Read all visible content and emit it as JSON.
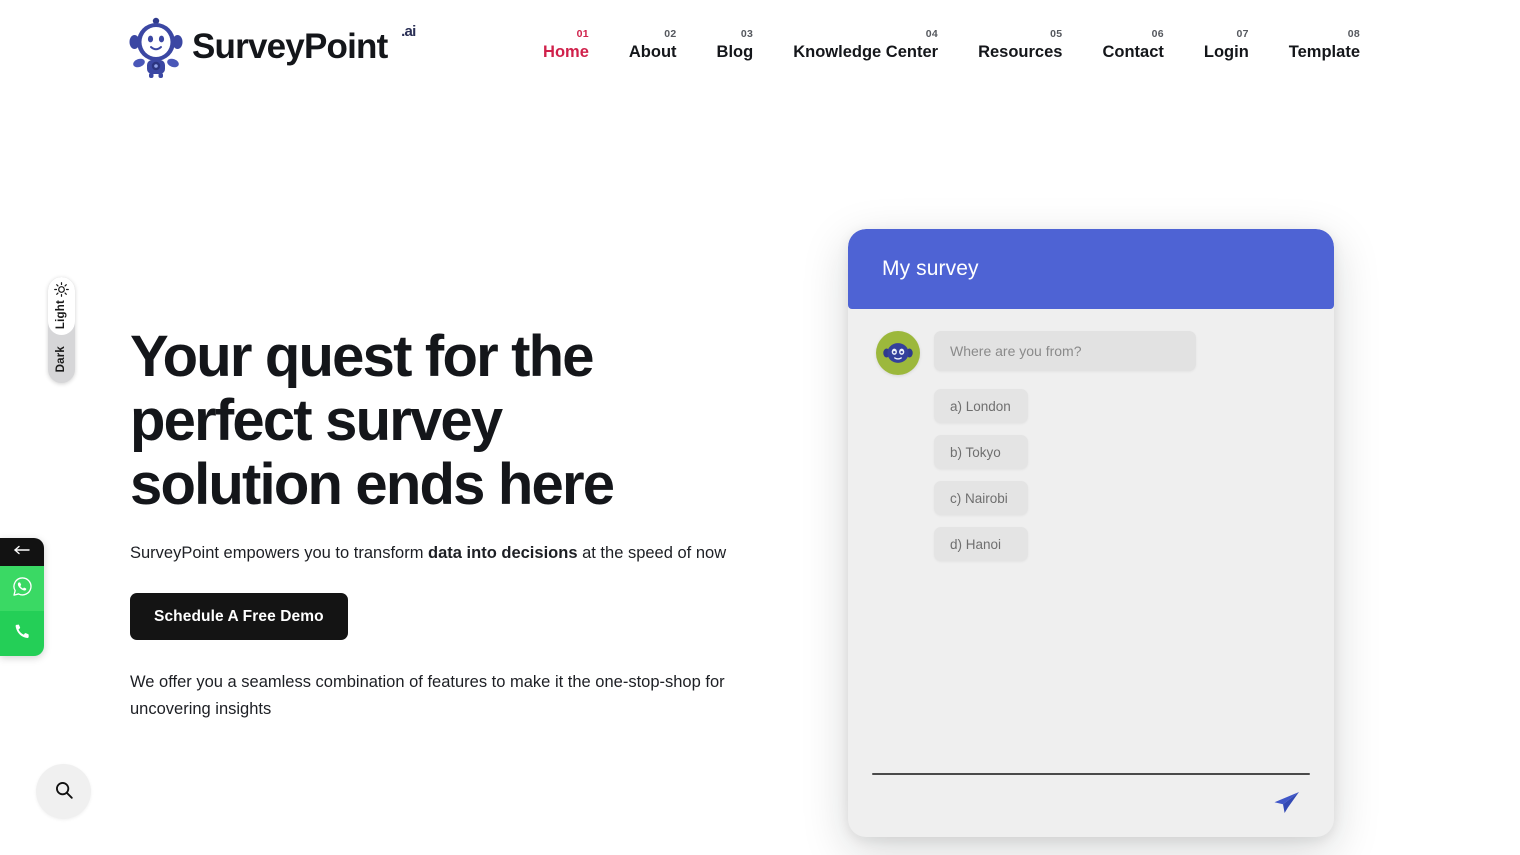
{
  "brand": {
    "name": "SurveyPoint",
    "suffix": ".ai",
    "logo_icon": "robot-mascot-icon"
  },
  "nav": {
    "items": [
      {
        "num": "01",
        "label": "Home",
        "active": true
      },
      {
        "num": "02",
        "label": "About",
        "active": false
      },
      {
        "num": "03",
        "label": "Blog",
        "active": false
      },
      {
        "num": "04",
        "label": "Knowledge Center",
        "active": false
      },
      {
        "num": "05",
        "label": "Resources",
        "active": false
      },
      {
        "num": "06",
        "label": "Contact",
        "active": false
      },
      {
        "num": "07",
        "label": "Login",
        "active": false
      },
      {
        "num": "08",
        "label": "Template",
        "active": false
      }
    ],
    "active_color": "#d0214b"
  },
  "theme_toggle": {
    "light_label": "Light",
    "dark_label": "Dark",
    "selected": "Light",
    "icon": "sun-icon"
  },
  "hero": {
    "title_line1": "Your quest for the",
    "title_line2": "perfect survey",
    "title_line3": "solution ends here",
    "sub_before": "SurveyPoint empowers you to transform ",
    "sub_bold": "data into decisions",
    "sub_after": " at the speed of now",
    "cta_label": "Schedule A Free Demo",
    "note": "We offer you a seamless combination of features to make it the one-stop-shop for uncovering insights"
  },
  "survey_card": {
    "title": "My survey",
    "header_color": "#4e63d4",
    "avatar_icon": "robot-avatar-icon",
    "avatar_color": "#9cb83c",
    "question": "Where are you from?",
    "options": [
      "a) London",
      "b) Tokyo",
      "c) Nairobi",
      "d) Hanoi"
    ],
    "send_icon": "send-paper-plane-icon",
    "send_color": "#3f56c8"
  },
  "contact_widget": {
    "collapse_icon": "arrow-left-icon",
    "items": [
      {
        "icon": "whatsapp-icon"
      },
      {
        "icon": "phone-icon"
      }
    ]
  },
  "search_fab": {
    "icon": "search-icon"
  }
}
